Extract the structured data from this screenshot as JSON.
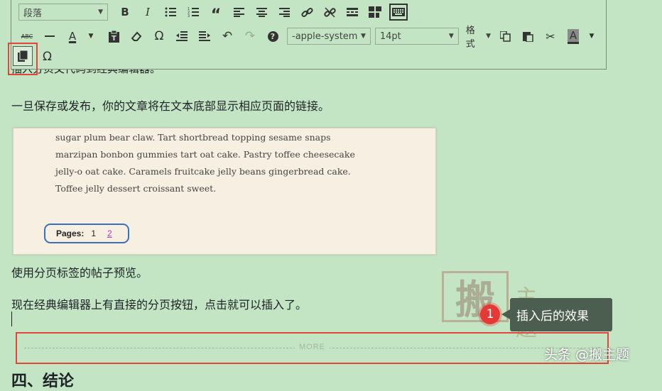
{
  "toolbar": {
    "format_select": "段落",
    "font_select": "-apple-system",
    "size_select": "14pt",
    "formats_label": "格式",
    "icons_row1": [
      "bold-icon",
      "italic-icon",
      "bullet-list-icon",
      "numbered-list-icon",
      "blockquote-icon",
      "align-left-icon",
      "align-center-icon",
      "align-right-icon",
      "link-icon",
      "unlink-icon",
      "read-more-icon",
      "toolbar-toggle-icon",
      "keyboard-icon"
    ],
    "icons_row2": [
      "strikethrough-icon",
      "horizontal-line-icon",
      "text-color-icon",
      "paste-text-icon",
      "clear-formatting-icon",
      "special-character-icon",
      "outdent-icon",
      "indent-icon",
      "undo-icon",
      "redo-icon",
      "help-icon"
    ],
    "icons_row3": [
      "page-break-icon",
      "special-character-icon"
    ]
  },
  "content": {
    "hidden_line": "插入分页文代码到经典编辑器。",
    "para1": "一旦保存或发布，你的文章将在文本底部显示相应页面的链接。",
    "preview_text": "sugar plum bear claw. Tart shortbread topping sesame snaps marzipan bonbon gummies tart oat cake. Pastry toffee cheesecake jelly-o oat cake. Caramels fruitcake jelly beans gingerbread cake. Toffee jelly dessert croissant sweet.",
    "pages_label": "Pages:",
    "page_current": "1",
    "page_link": "2",
    "caption": "使用分页标签的帖子预览。",
    "para2": "现在经典编辑器上有直接的分页按钮，点击就可以插入了。",
    "more_label": "MORE",
    "heading_peek": "四、结论"
  },
  "annotation": {
    "badge": "1",
    "tooltip": "插入后的效果"
  },
  "watermark": {
    "main_char": "搬",
    "rest": "主题"
  },
  "source": "头条 @搬主题",
  "colors": {
    "background": "#c4e5c4",
    "highlight": "#e0463c",
    "pagination_border": "#3a6fc4",
    "tooltip_bg": "#4c5e4f",
    "badge": "#e53935"
  }
}
